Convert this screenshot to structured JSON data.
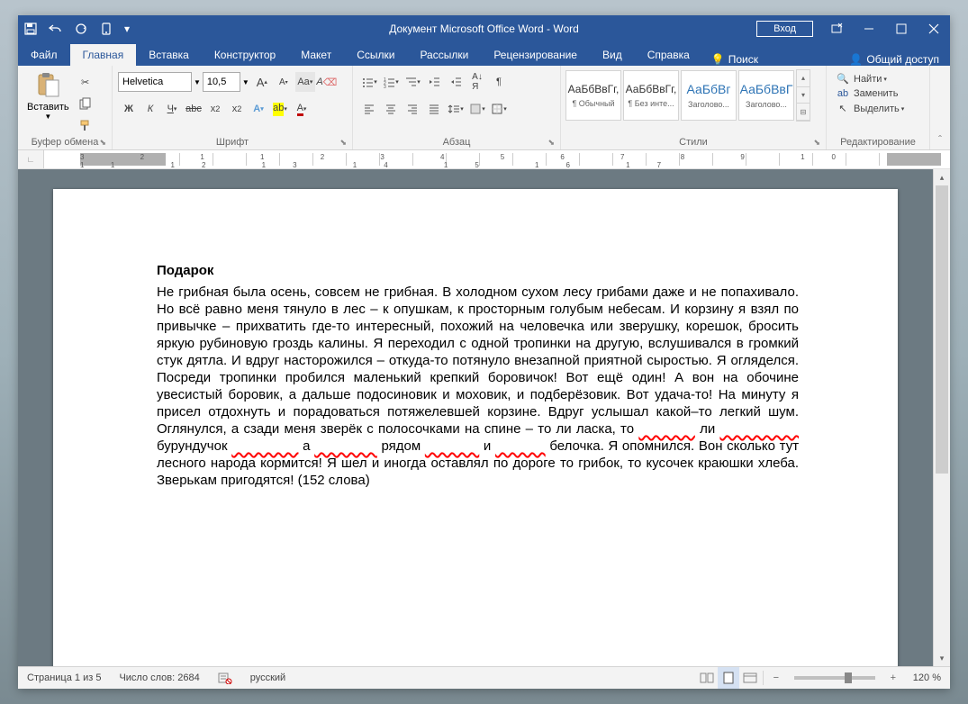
{
  "titlebar": {
    "title": "Документ Microsoft Office Word  -  Word",
    "signin": "Вход"
  },
  "tabs": {
    "file": "Файл",
    "home": "Главная",
    "insert": "Вставка",
    "design": "Конструктор",
    "layout": "Макет",
    "references": "Ссылки",
    "mailings": "Рассылки",
    "review": "Рецензирование",
    "view": "Вид",
    "help": "Справка",
    "tellme": "Поиск",
    "share": "Общий доступ"
  },
  "ribbon": {
    "clipboard": {
      "paste": "Вставить",
      "label": "Буфер обмена"
    },
    "font": {
      "name": "Helvetica",
      "size": "10,5",
      "label": "Шрифт"
    },
    "paragraph": {
      "label": "Абзац"
    },
    "styles": {
      "label": "Стили",
      "items": [
        {
          "sample": "АаБбВвГг,",
          "name": "¶ Обычный"
        },
        {
          "sample": "АаБбВвГг,",
          "name": "¶ Без инте..."
        },
        {
          "sample": "АаБбВг",
          "name": "Заголово..."
        },
        {
          "sample": "АаБбВвГ",
          "name": "Заголово..."
        }
      ]
    },
    "editing": {
      "find": "Найти",
      "replace": "Заменить",
      "select": "Выделить",
      "label": "Редактирование"
    }
  },
  "document": {
    "title": "Подарок",
    "p1": "Не грибная была осень, совсем не грибная. В холодном сухом лесу грибами даже и не попахивало. Но всё равно меня тянуло в лес – к опушкам, к просторным голубым небесам. И корзину я взял по привычке – прихватить где-то интересный, похожий на человечка или зверушку, корешок, бросить яркую рубиновую гроздь калины. Я переходил с одной тропинки на другую, вслушивался в громкий стук дятла. И вдруг насторожился – откуда-то потянуло внезапной приятной сыростью. Я огляделся. Посреди тропинки пробился маленький крепкий боровичок! Вот ещё один! А вон на обочине увесистый боровик, а дальше подосиновик и моховик, и подберёзовик. Вот удача-то! На минуту я присел отдохнуть и порадоваться потяжелевшей корзине. Вдруг услышал какой–то легкий шум. Оглянулся, а сзади меня зверёк с полосочками на спине – то ли ласка, то",
    "w1": "ли",
    "w2": "бурундучок",
    "w3": "а",
    "w4": "рядом",
    "w5": "и",
    "w6": "белочка.",
    "p2": "Я опомнился. Вон сколько тут лесного народа кормится! Я шел и иногда оставлял по дороге то грибок, то кусочек краюшки хлеба. Зверькам пригодятся! (152 слова)"
  },
  "statusbar": {
    "page": "Страница 1 из 5",
    "words": "Число слов: 2684",
    "lang": "русский",
    "zoom": "120 %"
  }
}
